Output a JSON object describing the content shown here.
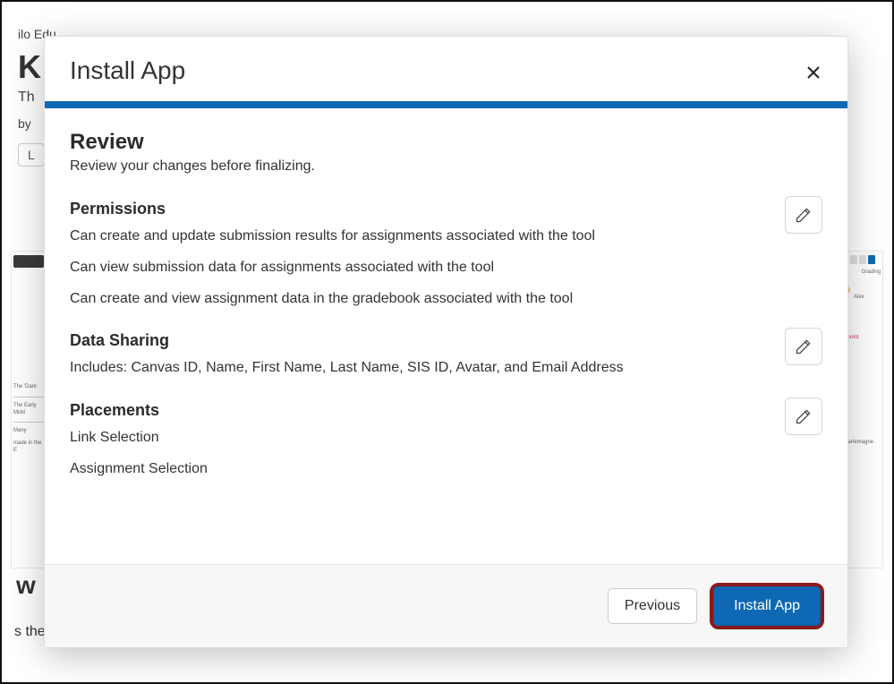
{
  "background": {
    "breadcrumb": "ilo Edu",
    "title_fragment": "K",
    "subtitle_fragment": "Th",
    "byline_fragment": "by",
    "pill_fragment": "L",
    "w_fragment": "w",
    "the_fragment": "s the"
  },
  "modal": {
    "title": "Install App",
    "review": {
      "heading": "Review",
      "subheading": "Review your changes before finalizing."
    },
    "permissions": {
      "heading": "Permissions",
      "items": [
        "Can create and update submission results for assignments associated with the tool",
        "Can view submission data for assignments associated with the tool",
        "Can create and view assignment data in the gradebook associated with the tool"
      ]
    },
    "data_sharing": {
      "heading": "Data Sharing",
      "text": "Includes: Canvas ID, Name, First Name, Last Name, SIS ID, Avatar, and Email Address"
    },
    "placements": {
      "heading": "Placements",
      "items": [
        "Link Selection",
        "Assignment Selection"
      ]
    },
    "footer": {
      "previous": "Previous",
      "install": "Install App"
    }
  }
}
